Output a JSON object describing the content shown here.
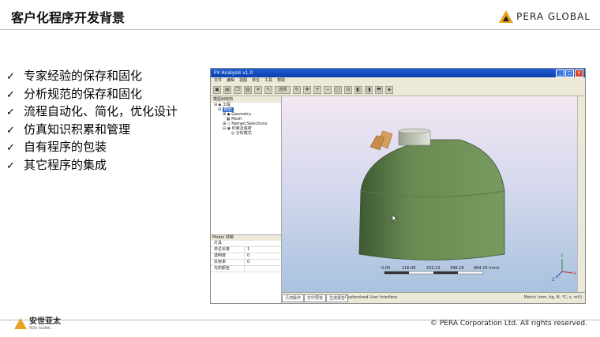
{
  "slide": {
    "title": "客户化程序开发背景",
    "brand": "PERA GLOBAL",
    "bullets": [
      "专家经验的保存和固化",
      "分析规范的保存和固化",
      "流程自动化、简化，优化设计",
      "仿真知识积累和管理",
      "自有程序的包装",
      "其它程序的集成"
    ],
    "bullet_mark": "✓",
    "footer_logo_cn": "安世亚太",
    "footer_logo_en": "PERA GLOBAL",
    "copyright": "© PERA Corporation Ltd. All rights reserved."
  },
  "app": {
    "window_title": "FV Analysis v1.0",
    "menu": [
      "文件",
      "编辑",
      "视图",
      "单位",
      "工具",
      "帮助"
    ],
    "toolbar_select": "选择",
    "tree_header": "模型树结构",
    "tree": {
      "root": "工程",
      "model": "模型",
      "items": [
        "Geometry",
        "Mesh",
        "Named Selections"
      ],
      "setup": "约束及载荷",
      "analysis": "分析模式"
    },
    "details_header": "Model 详细",
    "details_section": "灯具",
    "details_rows": [
      {
        "key": "单位长度",
        "value": "1"
      },
      {
        "key": "透明度",
        "value": "0"
      },
      {
        "key": "反射率",
        "value": "0"
      },
      {
        "key": "光的颜色",
        "value": ""
      }
    ],
    "scale_labels": [
      "0.00",
      "116.06",
      "232.12",
      "348.18",
      "464.23 (mm)"
    ],
    "axis_labels": {
      "x": "X",
      "y": "Y",
      "z": "Z"
    },
    "status_tabs": [
      "几何操作",
      "打印预览",
      "生成报告"
    ],
    "status_message": "Customized User Interface",
    "units": "Metric (mm, kg, N, °C, s, mV)",
    "colors": {
      "title_bar": "#0a3fae",
      "shell": "#6a8a52",
      "shell_dark": "#4c6a3e",
      "cap": "#c8cdbf",
      "part": "#d8a060",
      "accent_logo": "#e8a320"
    }
  }
}
